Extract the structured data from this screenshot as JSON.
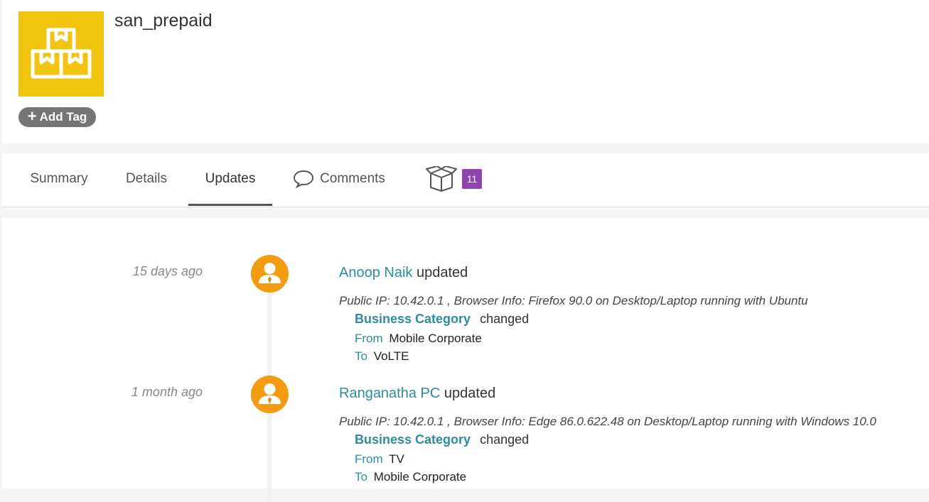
{
  "header": {
    "title": "san_prepaid",
    "add_tag_label": "Add Tag",
    "logo_icon": "boxes-icon",
    "logo_color": "#f1c40f"
  },
  "tabs": {
    "summary": "Summary",
    "details": "Details",
    "updates": "Updates",
    "comments": "Comments",
    "packages_count": "11",
    "active": "Updates"
  },
  "updates": [
    {
      "time": "15 days ago",
      "user": "Anoop Naik",
      "action": "updated",
      "meta": "Public IP: 10.42.0.1 , Browser Info: Firefox 90.0 on Desktop/Laptop running with Ubuntu",
      "field": "Business Category",
      "change_word": "changed",
      "from_label": "From",
      "from_value": "Mobile Corporate",
      "to_label": "To",
      "to_value": "VoLTE"
    },
    {
      "time": "1 month ago",
      "user": "Ranganatha PC",
      "action": "updated",
      "meta": "Public IP: 10.42.0.1 , Browser Info: Edge 86.0.622.48 on Desktop/Laptop running with Windows 10.0",
      "field": "Business Category",
      "change_word": "changed",
      "from_label": "From",
      "from_value": "TV",
      "to_label": "To",
      "to_value": "Mobile Corporate"
    }
  ]
}
